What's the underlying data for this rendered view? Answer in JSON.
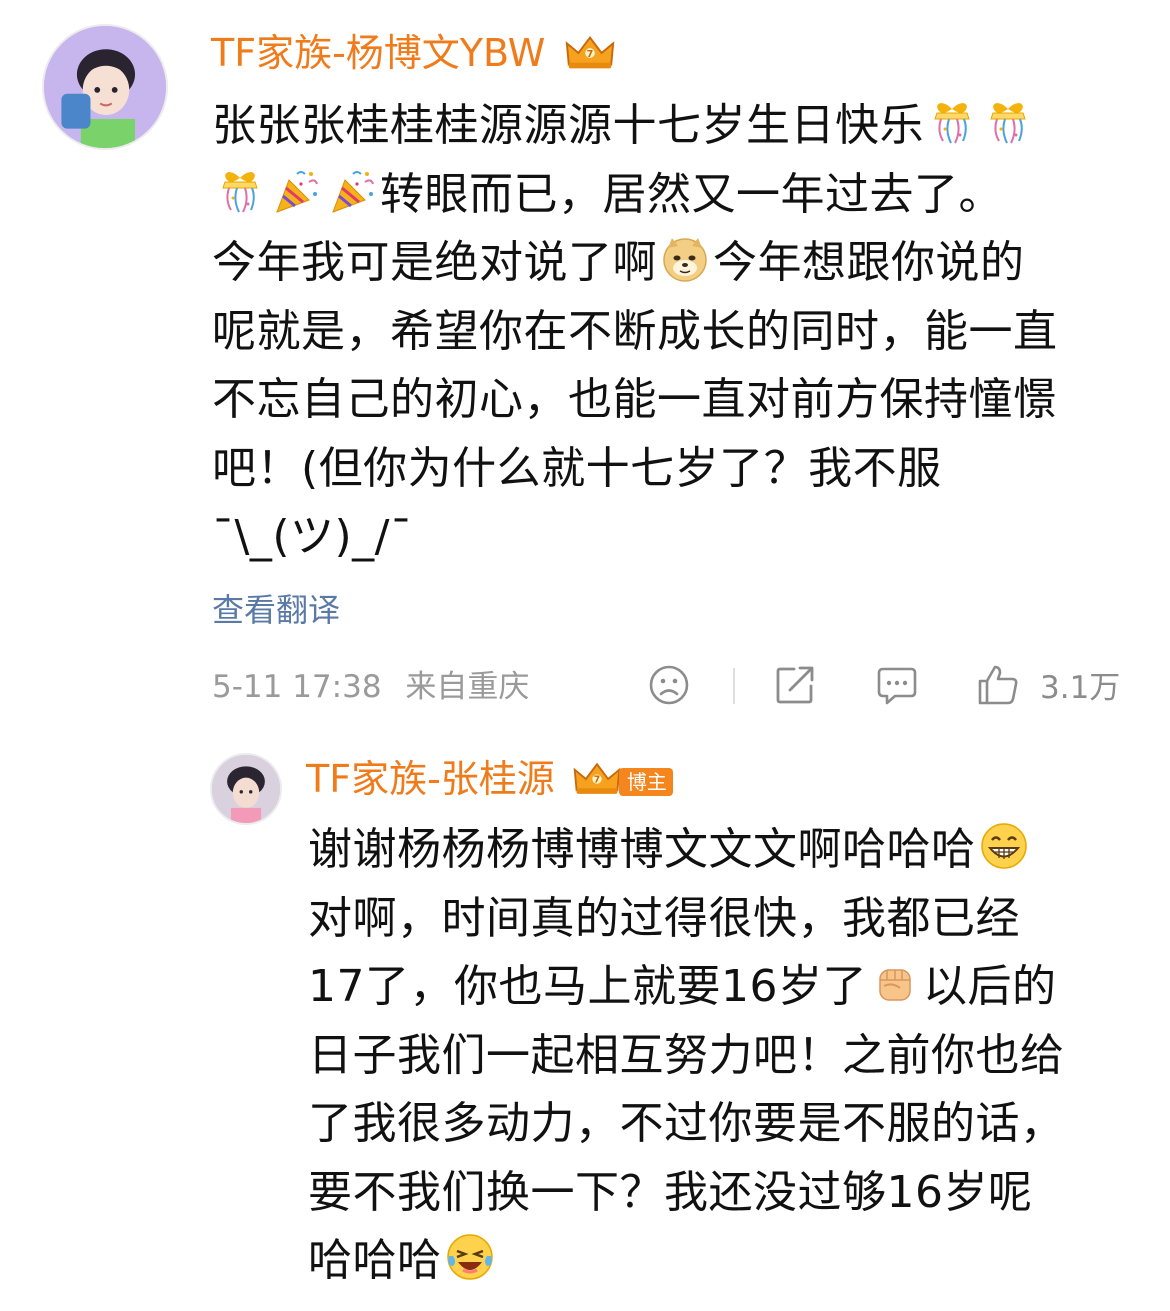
{
  "post": {
    "author": "TF家族-杨博文YBW",
    "avatar_icon": "user-avatar",
    "crown_icon": "vip-crown-icon",
    "lines": [
      {
        "parts": [
          {
            "t": "张张张桂桂桂源源源十七岁生日快乐"
          },
          {
            "e": "gift"
          },
          {
            "e": "gift"
          }
        ]
      },
      {
        "parts": [
          {
            "e": "gift"
          },
          {
            "e": "party"
          },
          {
            "e": "party"
          },
          {
            "t": "转眼而已，居然又一年过去了。"
          }
        ]
      },
      {
        "parts": [
          {
            "t": "今年我可是绝对说了啊"
          },
          {
            "e": "doge"
          },
          {
            "t": "今年想跟你说的"
          }
        ]
      },
      {
        "parts": [
          {
            "t": "呢就是，希望你在不断成长的同时，能一直"
          }
        ]
      },
      {
        "parts": [
          {
            "t": "不忘自己的初心，也能一直对前方保持憧憬"
          }
        ]
      },
      {
        "parts": [
          {
            "t": "吧！(但你为什么就十七岁了？我不服"
          }
        ]
      },
      {
        "parts": [
          {
            "t": "¯\\_(ツ)_/¯"
          }
        ]
      }
    ],
    "translate_label": "查看翻译",
    "timestamp": "5-11 17:38",
    "location": "来自重庆",
    "like_count": "3.1万"
  },
  "reply": {
    "author": "TF家族-张桂源",
    "avatar_icon": "user-avatar",
    "crown_icon": "vip-crown-icon",
    "role_badge": "博主",
    "lines": [
      {
        "parts": [
          {
            "t": "谢谢杨杨杨博博博文文文啊哈哈哈"
          },
          {
            "e": "grin"
          }
        ]
      },
      {
        "parts": [
          {
            "t": "对啊，时间真的过得很快，我都已经"
          }
        ]
      },
      {
        "parts": [
          {
            "t": "17了，你也马上就要16岁了"
          },
          {
            "e": "fist"
          },
          {
            "t": "以后的"
          }
        ]
      },
      {
        "parts": [
          {
            "t": "日子我们一起相互努力吧！之前你也给"
          }
        ]
      },
      {
        "parts": [
          {
            "t": "了我很多动力，不过你要是不服的话，"
          }
        ]
      },
      {
        "parts": [
          {
            "t": "要不我们换一下？我还没过够16岁呢"
          }
        ]
      },
      {
        "parts": [
          {
            "t": "哈哈哈"
          },
          {
            "e": "laugh"
          }
        ]
      }
    ]
  },
  "colors": {
    "accent": "#f07b1b",
    "link": "#5a7aa6",
    "meta": "#9a9a9a"
  }
}
